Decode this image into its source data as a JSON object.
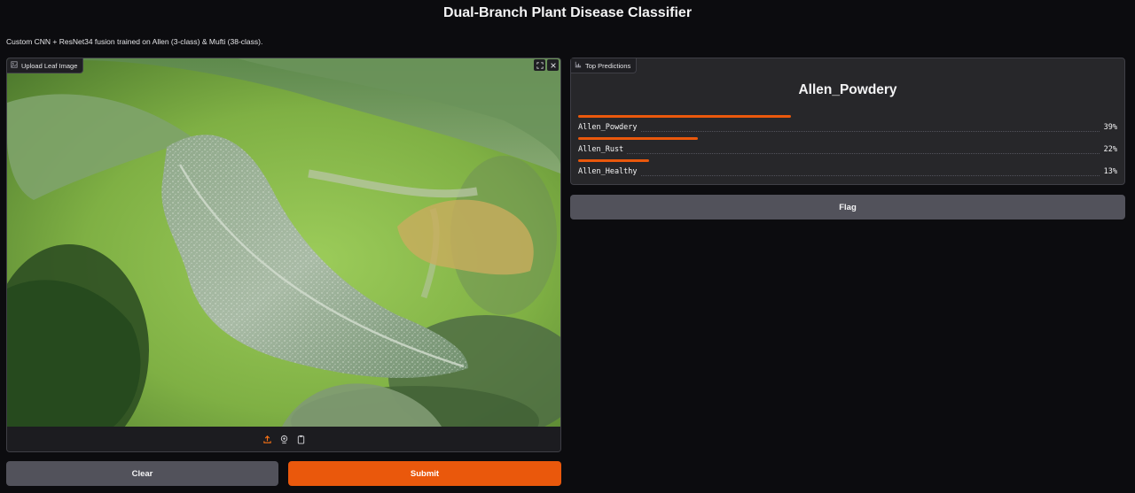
{
  "header": {
    "title": "Dual-Branch Plant Disease Classifier",
    "subtitle": "Custom CNN + ResNet34 fusion trained on Allen (3-class) & Mufti (38-class)."
  },
  "image_input": {
    "label": "Upload Leaf Image",
    "icon": "image-icon",
    "corner_icons": [
      "fullscreen-icon",
      "close-icon"
    ],
    "source_icons": [
      "upload-icon",
      "webcam-icon",
      "clipboard-icon"
    ]
  },
  "buttons": {
    "clear": "Clear",
    "submit": "Submit",
    "flag": "Flag"
  },
  "predictions": {
    "label": "Top Predictions",
    "icon": "bar-chart-icon",
    "top_label": "Allen_Powdery",
    "items": [
      {
        "name": "Allen_Powdery",
        "percent": "39%",
        "value": 0.39
      },
      {
        "name": "Allen_Rust",
        "percent": "22%",
        "value": 0.22
      },
      {
        "name": "Allen_Healthy",
        "percent": "13%",
        "value": 0.13
      }
    ]
  },
  "colors": {
    "accent": "#ea580c",
    "panel": "#27272a",
    "background": "#0c0c0f",
    "secondary_button": "#52525b"
  }
}
